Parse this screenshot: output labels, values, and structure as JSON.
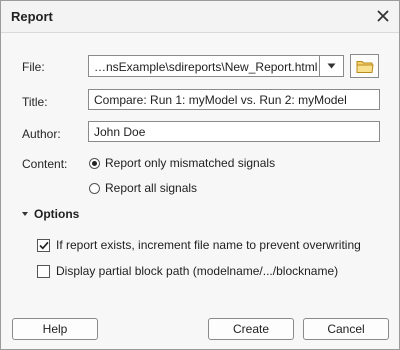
{
  "dialog": {
    "title": "Report"
  },
  "fields": {
    "file_label": "File:",
    "file_value": "…nsExample\\sdireports\\New_Report.html",
    "title_label": "Title:",
    "title_value": "Compare: Run 1: myModel vs. Run 2: myModel",
    "author_label": "Author:",
    "author_value": "John Doe",
    "content_label": "Content:"
  },
  "content_options": [
    {
      "label": "Report only mismatched signals",
      "selected": true
    },
    {
      "label": "Report all signals",
      "selected": false
    }
  ],
  "options": {
    "header": "Options",
    "increment_label": "If report exists, increment file name to prevent overwriting",
    "increment_checked": true,
    "partial_path_label": "Display partial block path (modelname/.../blockname)",
    "partial_path_checked": false
  },
  "buttons": {
    "help": "Help",
    "create": "Create",
    "cancel": "Cancel"
  },
  "colors": {
    "folder_icon": "#e8b84a"
  }
}
